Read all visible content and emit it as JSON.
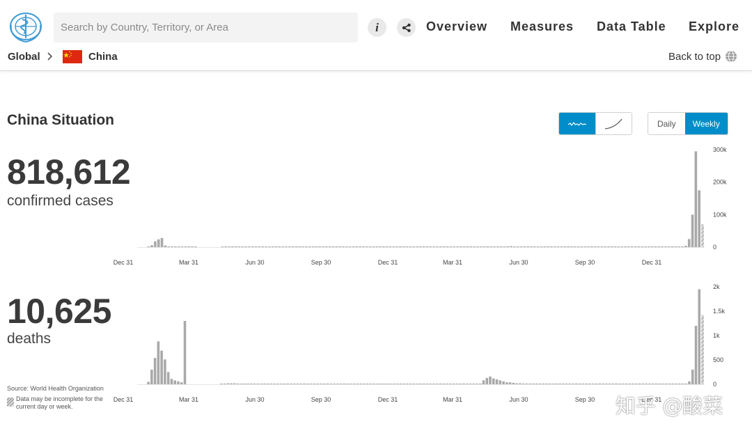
{
  "header": {
    "search_placeholder": "Search by Country, Territory, or Area",
    "info_icon": "i",
    "nav": [
      "Overview",
      "Measures",
      "Data Table",
      "Explore"
    ],
    "breadcrumb": {
      "global": "Global",
      "country": "China"
    },
    "back_to_top": "Back to top"
  },
  "situation": {
    "title": "China Situation",
    "chart_style_toggle": {
      "options": [
        "bar-icon",
        "line-icon"
      ],
      "selected": "bar-icon"
    },
    "period_toggle": {
      "options": [
        "Daily",
        "Weekly"
      ],
      "selected": "Weekly"
    }
  },
  "cases": {
    "total": "818,612",
    "label": "confirmed cases"
  },
  "deaths": {
    "total": "10,625",
    "label": "deaths"
  },
  "footer": {
    "source": "Source: World Health Organization",
    "note": "Data may be incomplete for the current day or week."
  },
  "watermark": "知乎 @酸菜",
  "colors": {
    "accent": "#008dc9",
    "bar": "#a9a9a9",
    "baseline": "#e6e6e6"
  },
  "chart_data": [
    {
      "type": "bar",
      "series": "confirmed cases (weekly)",
      "x_ticks": [
        "Dec 31",
        "Mar 31",
        "Jun 30",
        "Sep 30",
        "Dec 31",
        "Mar 31",
        "Jun 30",
        "Sep 30",
        "Dec 31"
      ],
      "y_ticks": [
        "300k",
        "200k",
        "100k",
        "0"
      ],
      "ylim": [
        0,
        300000
      ],
      "values": [
        0,
        0,
        0,
        1000,
        6000,
        18000,
        24000,
        28000,
        5000,
        1000,
        500,
        500,
        400,
        300,
        200,
        200,
        200,
        100,
        0,
        0,
        0,
        0,
        0,
        0,
        0,
        500,
        500,
        500,
        500,
        500,
        500,
        700,
        800,
        700,
        600,
        500,
        400,
        400,
        400,
        300,
        300,
        300,
        300,
        300,
        300,
        300,
        300,
        300,
        300,
        300,
        300,
        300,
        300,
        300,
        300,
        300,
        300,
        300,
        300,
        300,
        300,
        300,
        300,
        300,
        300,
        300,
        300,
        300,
        300,
        300,
        300,
        300,
        300,
        300,
        300,
        300,
        300,
        300,
        300,
        300,
        300,
        300,
        300,
        300,
        300,
        300,
        300,
        300,
        300,
        300,
        300,
        300,
        300,
        300,
        300,
        300,
        300,
        300,
        300,
        300,
        300,
        300,
        300,
        300,
        300,
        300,
        300,
        1000,
        2000,
        1500,
        2500,
        3000,
        2000,
        1500,
        1500,
        1000,
        1000,
        800,
        800,
        600,
        500,
        500,
        500,
        500,
        500,
        500,
        500,
        500,
        500,
        500,
        500,
        500,
        500,
        500,
        500,
        500,
        500,
        500,
        500,
        500,
        500,
        500,
        500,
        500,
        500,
        500,
        500,
        500,
        500,
        500,
        500,
        500,
        500,
        600,
        700,
        700,
        800,
        800,
        900,
        1000,
        1200,
        1500,
        2000,
        4000,
        25000,
        100000,
        295000,
        175000,
        70000
      ],
      "last_value_incomplete": true
    },
    {
      "type": "bar",
      "series": "deaths (weekly)",
      "x_ticks": [
        "Dec 31",
        "Mar 31",
        "Jun 30",
        "Sep 30",
        "Dec 31",
        "Mar 31",
        "Jun 30",
        "Sep 30",
        "Dec 31"
      ],
      "y_ticks": [
        "2k",
        "1.5k",
        "1k",
        "500",
        "0"
      ],
      "ylim": [
        0,
        2000
      ],
      "values": [
        0,
        0,
        0,
        50,
        300,
        540,
        880,
        690,
        510,
        250,
        110,
        80,
        60,
        40,
        1300,
        0,
        0,
        0,
        0,
        0,
        0,
        0,
        0,
        0,
        0,
        10,
        10,
        20,
        20,
        20,
        15,
        10,
        10,
        10,
        10,
        5,
        5,
        5,
        5,
        5,
        5,
        5,
        5,
        5,
        5,
        5,
        5,
        10,
        10,
        10,
        10,
        10,
        10,
        10,
        10,
        10,
        10,
        10,
        10,
        5,
        5,
        5,
        5,
        5,
        5,
        5,
        5,
        5,
        5,
        5,
        5,
        5,
        5,
        5,
        5,
        5,
        5,
        5,
        5,
        5,
        5,
        5,
        5,
        5,
        5,
        5,
        5,
        5,
        5,
        5,
        5,
        5,
        5,
        5,
        5,
        5,
        5,
        5,
        5,
        5,
        5,
        5,
        5,
        5,
        80,
        130,
        160,
        120,
        100,
        80,
        60,
        40,
        40,
        30,
        20,
        20,
        15,
        15,
        15,
        15,
        15,
        15,
        15,
        15,
        15,
        15,
        15,
        15,
        15,
        15,
        15,
        15,
        15,
        15,
        15,
        15,
        15,
        15,
        15,
        15,
        15,
        15,
        15,
        15,
        15,
        15,
        15,
        15,
        15,
        15,
        15,
        15,
        15,
        15,
        15,
        15,
        15,
        15,
        15,
        15,
        15,
        15,
        15,
        15,
        15,
        15,
        60,
        300,
        1200,
        1950,
        1420
      ],
      "last_value_incomplete": true
    }
  ]
}
